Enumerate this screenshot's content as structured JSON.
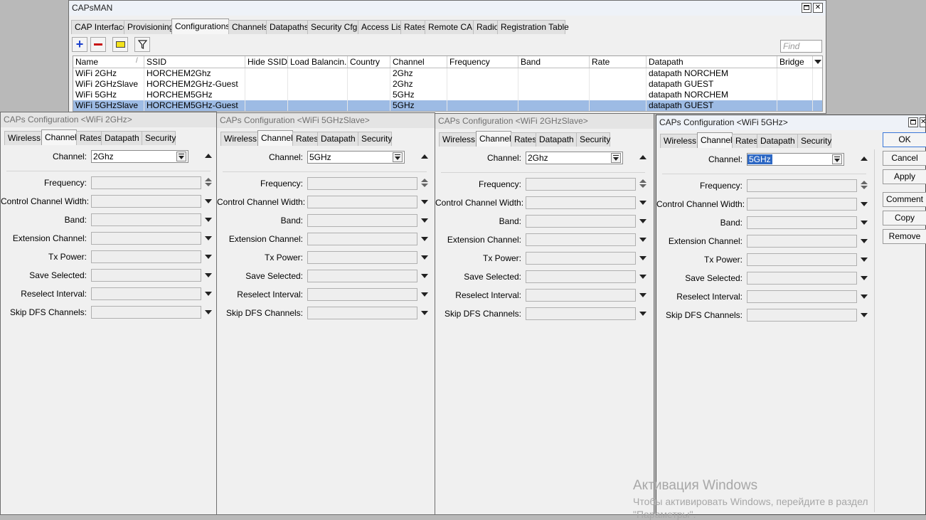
{
  "capsman": {
    "title": "CAPsMAN",
    "tabs": [
      "CAP Interface",
      "Provisioning",
      "Configurations",
      "Channels",
      "Datapaths",
      "Security Cfg.",
      "Access List",
      "Rates",
      "Remote CAP",
      "Radio",
      "Registration Table"
    ],
    "active_tab": "Configurations",
    "find_placeholder": "Find",
    "columns": [
      "Name",
      "SSID",
      "Hide SSID",
      "Load Balancin...",
      "Country",
      "Channel",
      "Frequency",
      "Band",
      "Rate",
      "Datapath",
      "Bridge"
    ],
    "rows": [
      [
        "WiFi 2GHz",
        "HORCHEM2Ghz",
        "",
        "",
        "",
        "2Ghz",
        "",
        "",
        "",
        "datapath NORCHEM",
        ""
      ],
      [
        "WiFi 2GHzSlave",
        "HORCHEM2GHz-Guest",
        "",
        "",
        "",
        "2Ghz",
        "",
        "",
        "",
        "datapath GUEST",
        ""
      ],
      [
        "WiFi 5GHz",
        "HORCHEM5GHz",
        "",
        "",
        "",
        "5GHz",
        "",
        "",
        "",
        "datapath NORCHEM",
        ""
      ],
      [
        "WiFi 5GHzSlave",
        "HORCHEM5GHz-Guest",
        "",
        "",
        "",
        "5GHz",
        "",
        "",
        "",
        "datapath GUEST",
        ""
      ]
    ],
    "selected_row": 3
  },
  "dialogs": [
    {
      "title": "CAPs Configuration <WiFi 2GHz>",
      "tabs": [
        "Wireless",
        "Channel",
        "Rates",
        "Datapath",
        "Security"
      ],
      "active_tab": "Channel",
      "channel": "2Ghz"
    },
    {
      "title": "CAPs Configuration <WiFi 5GHzSlave>",
      "tabs": [
        "Wireless",
        "Channel",
        "Rates",
        "Datapath",
        "Security"
      ],
      "active_tab": "Channel",
      "channel": "5GHz"
    },
    {
      "title": "CAPs Configuration <WiFi 2GHzSlave>",
      "tabs": [
        "Wireless",
        "Channel",
        "Rates",
        "Datapath",
        "Security"
      ],
      "active_tab": "Channel",
      "channel": "2Ghz"
    },
    {
      "title": "CAPs Configuration <WiFi 5GHz>",
      "tabs": [
        "Wireless",
        "Channel",
        "Rates",
        "Datapath",
        "Security"
      ],
      "active_tab": "Channel",
      "channel": "5GHz"
    }
  ],
  "field_labels": {
    "channel": "Channel:",
    "frequency": "Frequency:",
    "control_channel_width": "Control Channel Width:",
    "band": "Band:",
    "extension_channel": "Extension Channel:",
    "tx_power": "Tx Power:",
    "save_selected": "Save Selected:",
    "reselect_interval": "Reselect Interval:",
    "skip_dfs_channels": "Skip DFS Channels:"
  },
  "side_buttons": [
    "OK",
    "Cancel",
    "Apply",
    "Comment",
    "Copy",
    "Remove"
  ],
  "watermark": {
    "line1": "Активация Windows",
    "line2": "Чтобы активировать Windows, перейдите в раздел",
    "line3": "\"Параметры\"."
  },
  "icons": {
    "add": "plus-icon",
    "remove": "minus-icon",
    "comment": "note-icon",
    "filter": "filter-icon"
  },
  "colors": {
    "selection": "#9dbbe4",
    "add_icon": "#1b3fcc",
    "remove_icon": "#c81414",
    "note_icon": "#f3e21b"
  }
}
